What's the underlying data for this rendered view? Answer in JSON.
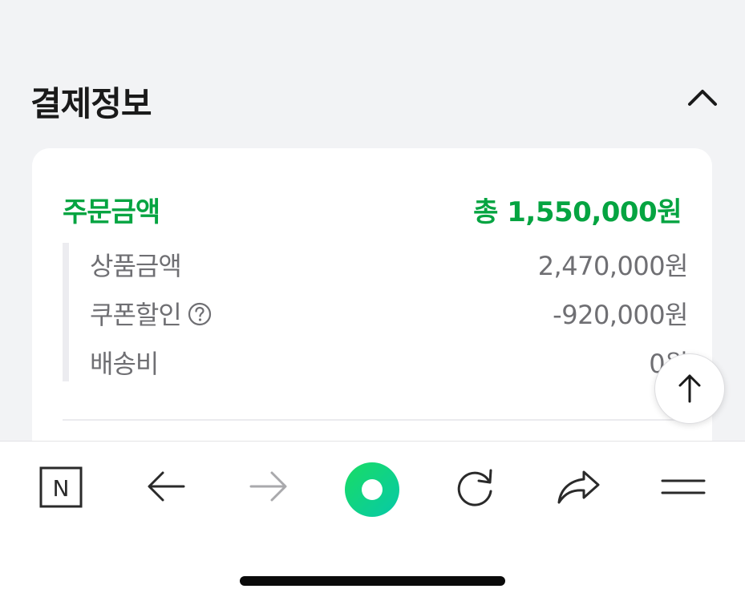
{
  "section": {
    "title": "결제정보",
    "collapse_icon": "chevron-up-icon"
  },
  "order": {
    "label": "주문금액",
    "total": "총 1,550,000원",
    "accent_color": "#05a441"
  },
  "details": [
    {
      "label": "상품금액",
      "value": "2,470,000원"
    },
    {
      "label": "쿠폰할인",
      "value": "-920,000원",
      "help_icon": "question-circle-icon"
    },
    {
      "label": "배송비",
      "value": "0원"
    }
  ],
  "scroll_top_icon": "arrow-up-icon",
  "toolbar": {
    "items": [
      "naver-home-icon",
      "back-arrow-icon",
      "forward-arrow-icon",
      "green-dot-icon",
      "refresh-icon",
      "share-icon",
      "menu-icon"
    ],
    "home_label": "N",
    "forward_disabled": true
  }
}
